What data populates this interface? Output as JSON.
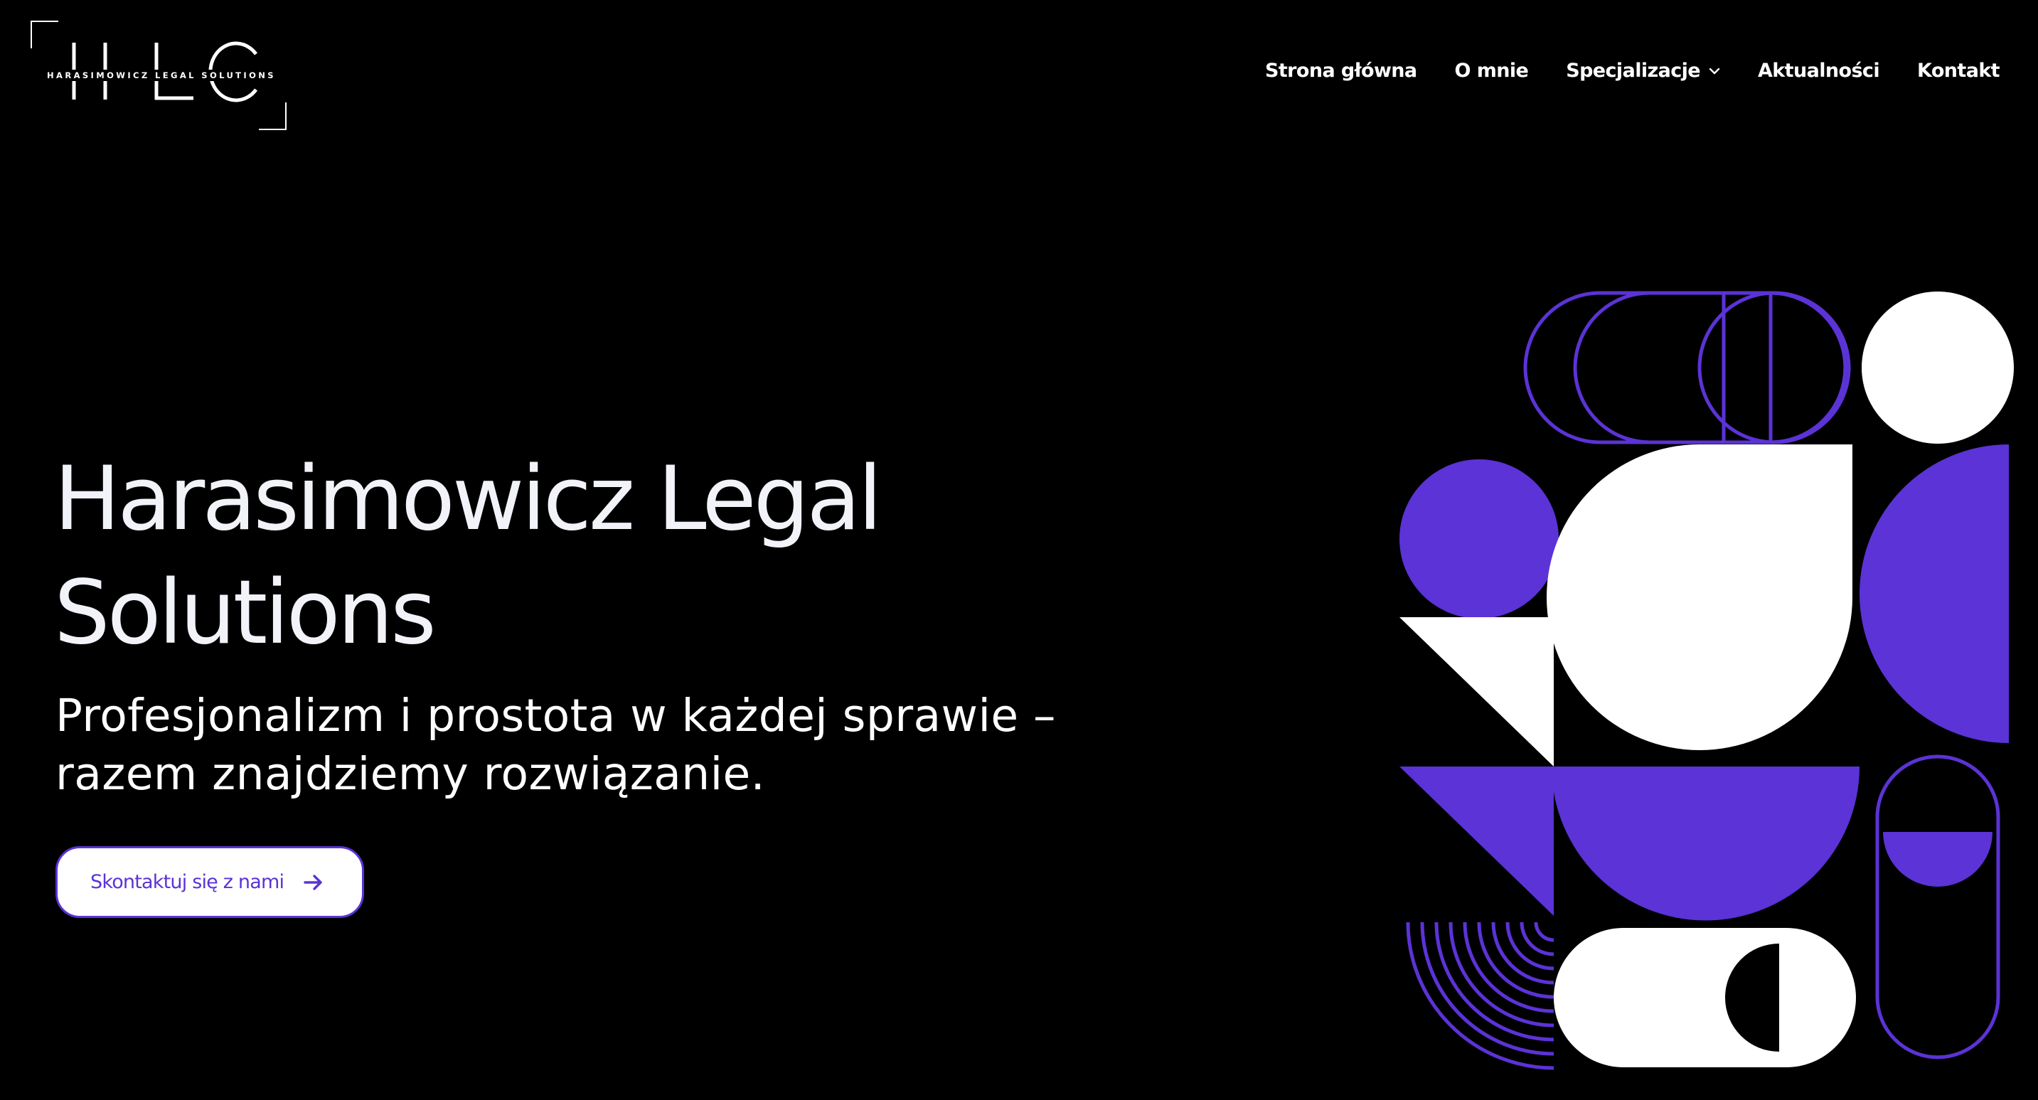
{
  "logo": {
    "letters": "HLC",
    "name": "HARASIMOWICZ LEGAL SOLUTIONS"
  },
  "nav": {
    "items": [
      {
        "label": "Strona główna"
      },
      {
        "label": "O mnie"
      },
      {
        "label": "Specjalizacje",
        "icon": "chevron-down-icon"
      },
      {
        "label": "Aktualności"
      },
      {
        "label": "Kontakt"
      }
    ]
  },
  "hero": {
    "title_line1": "Harasimowicz Legal",
    "title_line2": "Solutions",
    "subtitle_line1": "Profesjonalizm i prostota w każdej sprawie –",
    "subtitle_line2": "razem znajdziemy rozwiązanie.",
    "cta_label": "Skontaktuj się z nami",
    "cta_icon": "arrow-right-icon"
  },
  "colors": {
    "background": "#000000",
    "accent": "#5b33d6",
    "text": "#ffffff"
  }
}
